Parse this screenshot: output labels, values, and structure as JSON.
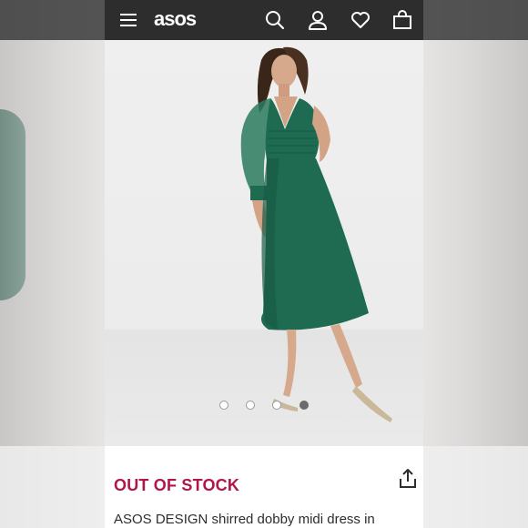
{
  "header": {
    "logo": "asos",
    "icons": [
      "menu-icon",
      "search-icon",
      "account-icon",
      "heart-icon",
      "bag-icon"
    ]
  },
  "product": {
    "image_alt": "Model wearing green shirred dobby midi dress",
    "carousel": {
      "total": 4,
      "active": 4
    },
    "stock_status": "OUT OF STOCK",
    "title": "ASOS DESIGN shirred dobby midi dress in"
  },
  "colors": {
    "header_bg": "#2d2d2d",
    "stock": "#b0164a",
    "dress": "#1f6b52"
  }
}
